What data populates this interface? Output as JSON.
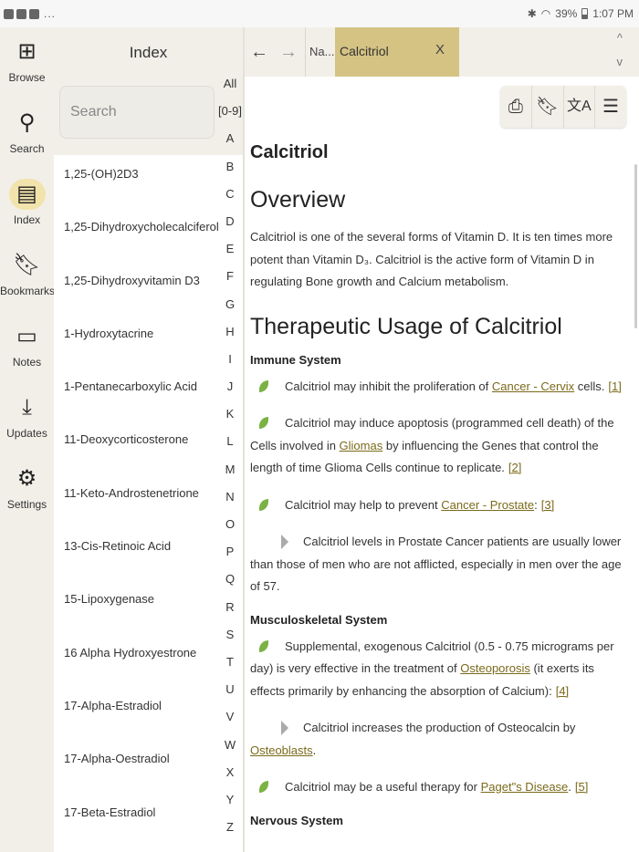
{
  "status": {
    "battery": "39%",
    "time": "1:07 PM",
    "overflow": "..."
  },
  "nav": [
    {
      "label": "Browse",
      "icon": "browse-icon",
      "glyph": "⊞"
    },
    {
      "label": "Search",
      "icon": "search-icon",
      "glyph": "⚲"
    },
    {
      "label": "Index",
      "icon": "index-icon",
      "glyph": "▤"
    },
    {
      "label": "Bookmarks",
      "icon": "bookmark-icon",
      "glyph": "🔖︎"
    },
    {
      "label": "Notes",
      "icon": "notes-icon",
      "glyph": "▭"
    },
    {
      "label": "Updates",
      "icon": "download-icon",
      "glyph": "⤓"
    },
    {
      "label": "Settings",
      "icon": "gear-icon",
      "glyph": "⚙"
    }
  ],
  "index": {
    "title": "Index",
    "search_placeholder": "Search",
    "entries": [
      "1,25-(OH)2D3",
      "1,25-Dihydroxycholecalciferol",
      "1,25-Dihydroxyvitamin D3",
      "1-Hydroxytacrine",
      "1-Pentanecarboxylic Acid",
      "11-Deoxycorticosterone",
      "11-Keto-Androstenetrione",
      "13-Cis-Retinoic Acid",
      "15-Lipoxygenase",
      "16 Alpha Hydroxyestrone",
      "17-Alpha-Estradiol",
      "17-Alpha-Oestradiol",
      "17-Beta-Estradiol"
    ],
    "alphabet": [
      "All",
      "[0-9]",
      "A",
      "B",
      "C",
      "D",
      "E",
      "F",
      "G",
      "H",
      "I",
      "J",
      "K",
      "L",
      "M",
      "N",
      "O",
      "P",
      "Q",
      "R",
      "S",
      "T",
      "U",
      "V",
      "W",
      "X",
      "Y",
      "Z"
    ]
  },
  "tabs": {
    "back": "←",
    "forward": "→",
    "inactive_tab": "Na...",
    "active_tab": "Calcitriol",
    "close": "X",
    "scroll_up": "^",
    "scroll_down": "v"
  },
  "toolbar": {
    "print": "⎙",
    "bookmark": "🔖︎",
    "translate": "文A",
    "notes": "☰"
  },
  "doc": {
    "title": "Calcitriol",
    "overview_heading": "Overview",
    "overview_text": "Calcitriol is one of the several forms of Vitamin D.  It is ten times more potent than Vitamin D₃.  Calcitriol is the active form of Vitamin D in regulating Bone growth and Calcium metabolism.",
    "usage_heading": "Therapeutic Usage of Calcitriol",
    "immune_heading": "Immune System",
    "b1_text": "Calcitriol may inhibit the proliferation of ",
    "b1_link": "Cancer - Cervix",
    "b1_after": " cells.",
    "b1_ref": "[1]",
    "b2_text": "Calcitriol may induce apoptosis (programmed cell death) of the Cells involved in ",
    "b2_link": "Gliomas",
    "b2_after": " by influencing the Genes that control the length of time Glioma Cells continue to replicate.",
    "b2_ref": "[2]",
    "b3_text": "Calcitriol may help to prevent ",
    "b3_link": "Cancer - Prostate",
    "b3_after": ":",
    "b3_ref": "[3]",
    "b3_sub": "Calcitriol levels in Prostate Cancer patients are usually lower than those of men who are not afflicted, especially in men over the age of 57.",
    "musculo_heading": "Musculoskeletal System",
    "b4_text": "Supplemental, exogenous Calcitriol (0.5 - 0.75 micrograms per day) is very effective in the treatment of ",
    "b4_link": "Osteoporosis",
    "b4_after": " (it exerts its effects primarily by enhancing the absorption of Calcium):",
    "b4_ref": "[4]",
    "b4_sub_text": "Calcitriol increases the production of Osteocalcin by ",
    "b4_sub_link": "Osteoblasts",
    "b4_sub_after": ".",
    "b5_text": "Calcitriol may be a useful therapy for ",
    "b5_link": "Paget\"s Disease",
    "b5_after": ".",
    "b5_ref": "[5]",
    "nervous_heading": "Nervous System"
  }
}
